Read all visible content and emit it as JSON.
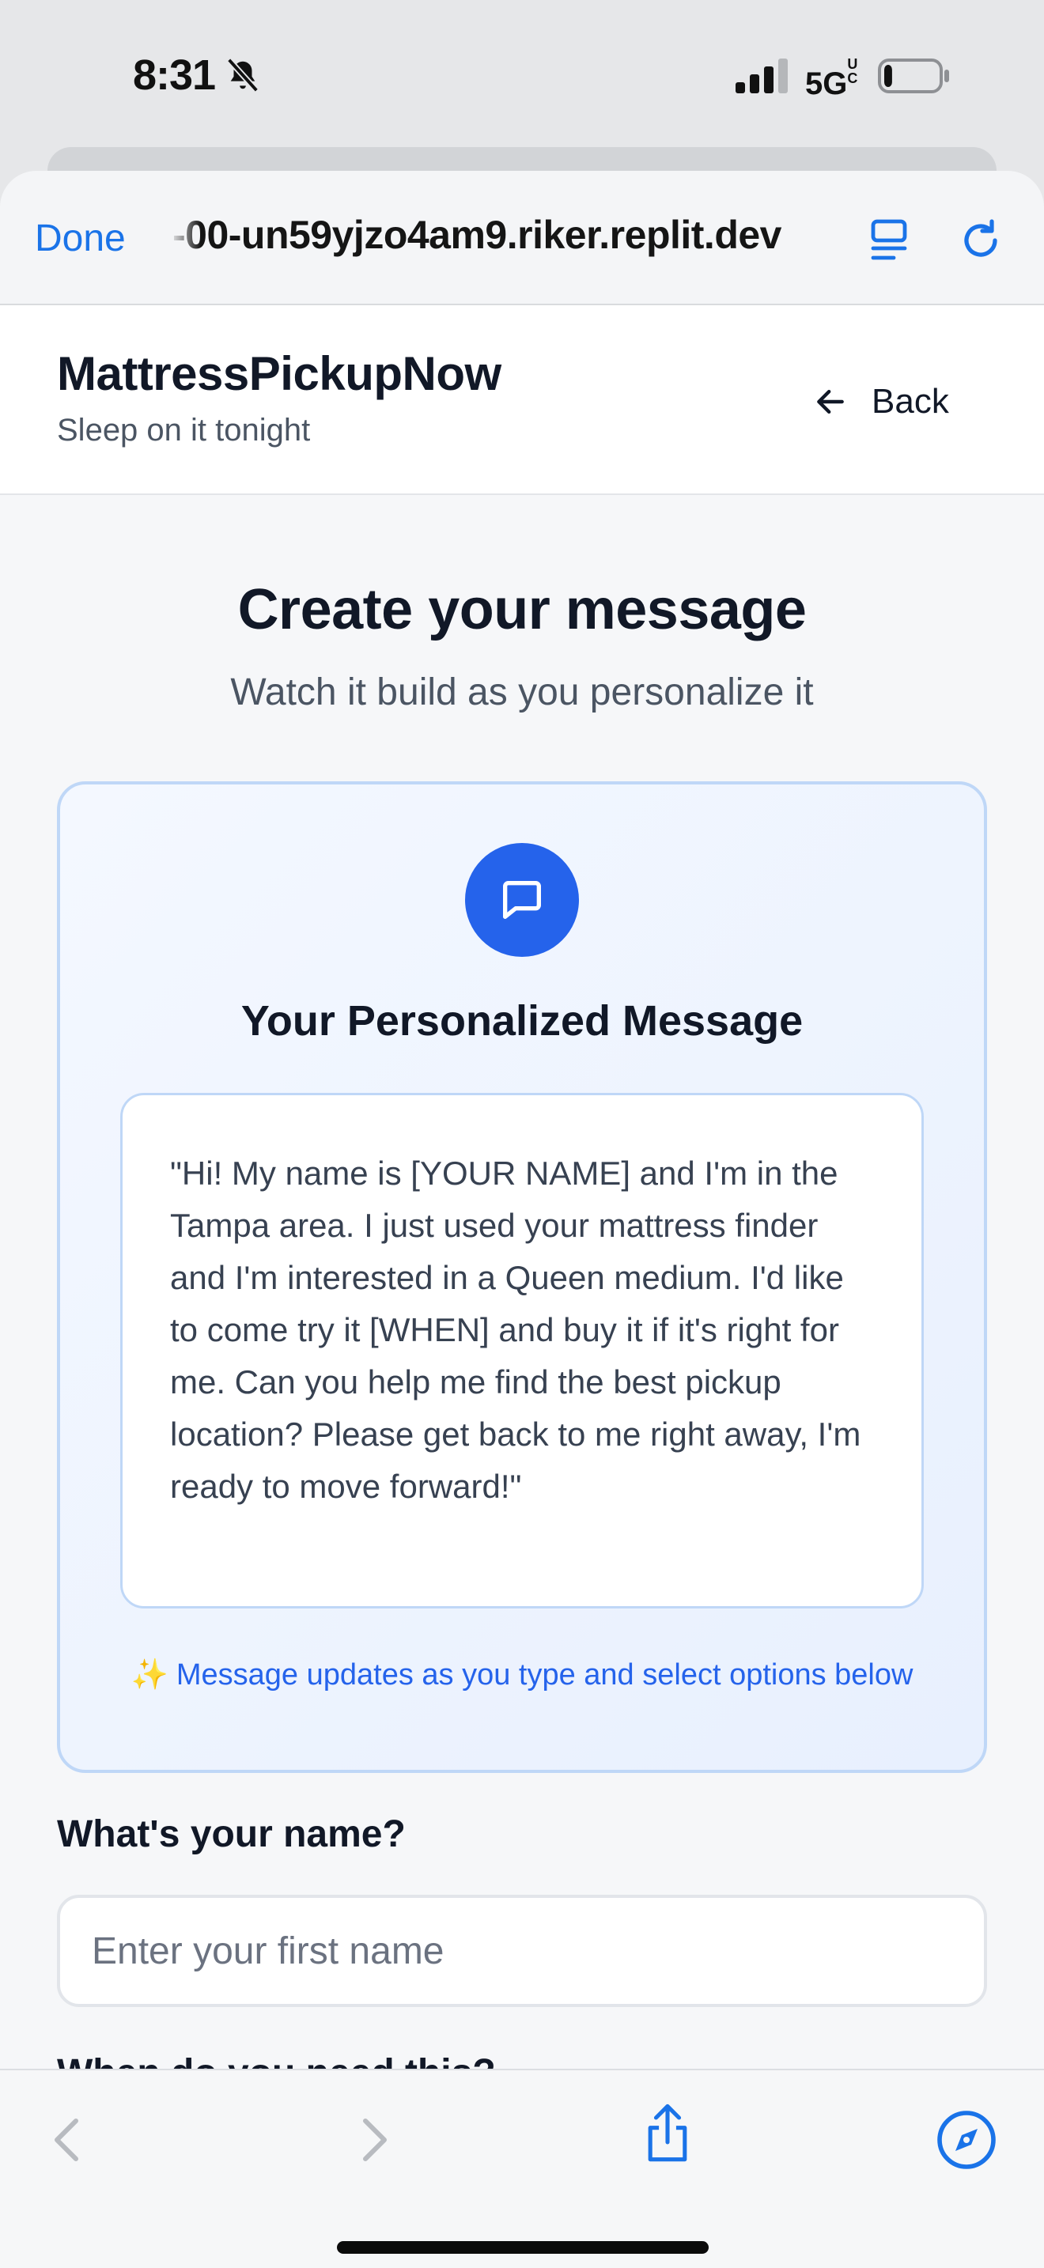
{
  "status_bar": {
    "time": "8:31",
    "network": "5G",
    "network_suffix": "UC",
    "battery_level": 0.15
  },
  "browser": {
    "done_label": "Done",
    "url": "-00-un59yjzo4am9.riker.replit.dev",
    "accent_color": "#1a73e8"
  },
  "header": {
    "brand": "MattressPickupNow",
    "tagline": "Sleep on it tonight",
    "back_label": "Back"
  },
  "main": {
    "title": "Create your message",
    "subtitle": "Watch it build as you personalize it",
    "preview": {
      "title": "Your Personalized Message",
      "message": "\"Hi! My name is [YOUR NAME] and I'm in the Tampa area. I just used your mattress finder and I'm interested in a Queen medium. I'd like to come try it [WHEN] and buy it if it's right for me. Can you help me find the best pickup location? Please get back to me right away, I'm ready to move forward!\"",
      "hint": "Message updates as you type and select options below",
      "hint_emoji": "✨",
      "accent_color": "#2563eb"
    },
    "name_field": {
      "label": "What's your name?",
      "placeholder": "Enter your first name",
      "value": ""
    },
    "next_label": "When do you need this?"
  },
  "toolbar": {
    "icons": [
      "chevron-left-icon",
      "chevron-right-icon",
      "share-icon",
      "compass-icon"
    ]
  }
}
